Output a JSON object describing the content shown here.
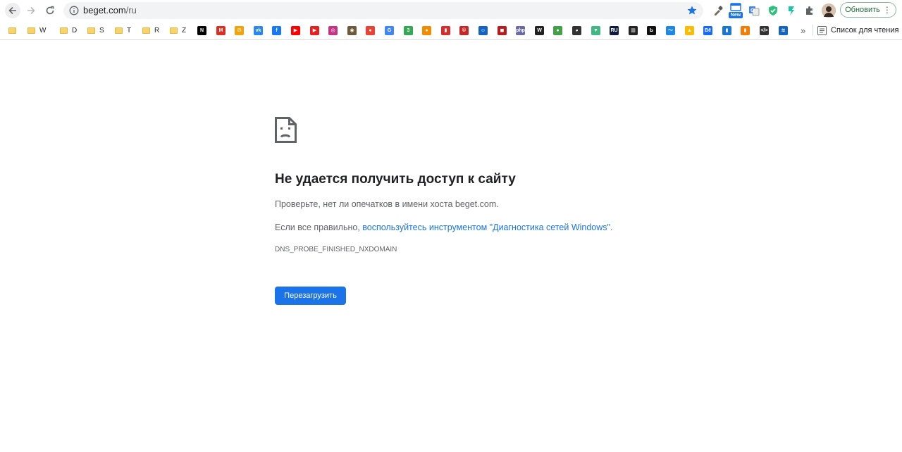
{
  "browser": {
    "url_host": "beget.com",
    "url_path": "/ru",
    "update_label": "Обновить",
    "reading_list_label": "Список для чтения",
    "overflow_label": "»",
    "new_badge": "New"
  },
  "bookmarks": [
    {
      "type": "folder",
      "label": ""
    },
    {
      "type": "folder",
      "label": "W"
    },
    {
      "type": "folder",
      "label": "D"
    },
    {
      "type": "folder",
      "label": "S"
    },
    {
      "type": "folder",
      "label": "T"
    },
    {
      "type": "folder",
      "label": "R"
    },
    {
      "type": "folder",
      "label": "Z"
    }
  ],
  "favicons": [
    {
      "icon": "notion-icon",
      "glyph": "N",
      "color": "#000000"
    },
    {
      "icon": "gmail-icon",
      "glyph": "M",
      "color": "#d93025"
    },
    {
      "icon": "mail-icon",
      "glyph": "✉",
      "color": "#f0a30a"
    },
    {
      "icon": "vk-icon",
      "glyph": "vk",
      "color": "#2787f5"
    },
    {
      "icon": "facebook-icon",
      "glyph": "f",
      "color": "#1877f2"
    },
    {
      "icon": "youtube-icon",
      "glyph": "▶",
      "color": "#ff0000"
    },
    {
      "icon": "youtube-music-icon",
      "glyph": "▶",
      "color": "#e52222"
    },
    {
      "icon": "instagram-icon",
      "glyph": "◎",
      "color": "#c13584"
    },
    {
      "icon": "eye-icon",
      "glyph": "◉",
      "color": "#6d5a3a"
    },
    {
      "icon": "maps-pin-icon",
      "glyph": "●",
      "color": "#ea4335"
    },
    {
      "icon": "translate-icon",
      "glyph": "G",
      "color": "#4285f4"
    },
    {
      "icon": "three-icon",
      "glyph": "3",
      "color": "#34a853"
    },
    {
      "icon": "basketball-icon",
      "glyph": "●",
      "color": "#f28b00"
    },
    {
      "icon": "analytics-icon",
      "glyph": "▮",
      "color": "#d32f2f"
    },
    {
      "icon": "copyright-icon",
      "glyph": "©",
      "color": "#c62828"
    },
    {
      "icon": "robot-icon",
      "glyph": "☺",
      "color": "#1565c0"
    },
    {
      "icon": "game-icon",
      "glyph": "◼",
      "color": "#b71c1c"
    },
    {
      "icon": "php-icon",
      "glyph": "php",
      "color": "#6a6aa8"
    },
    {
      "icon": "w-icon",
      "glyph": "W",
      "color": "#222222"
    },
    {
      "icon": "green-dot-icon",
      "glyph": "●",
      "color": "#43a047"
    },
    {
      "icon": "panda-icon",
      "glyph": "◕",
      "color": "#333333"
    },
    {
      "icon": "vue-icon",
      "glyph": "▼",
      "color": "#41b883"
    },
    {
      "icon": "ru-icon",
      "glyph": "RU",
      "color": "#0d1b3e"
    },
    {
      "icon": "archive-icon",
      "glyph": "▥",
      "color": "#222222"
    },
    {
      "icon": "b-icon",
      "glyph": "Ь",
      "color": "#111111"
    },
    {
      "icon": "wave-icon",
      "glyph": "〜",
      "color": "#1e88e5"
    },
    {
      "icon": "drive-icon",
      "glyph": "▲",
      "color": "#fbbc04"
    },
    {
      "icon": "behance-icon",
      "glyph": "Bē",
      "color": "#1769ff"
    },
    {
      "icon": "bars-icon",
      "glyph": "▮",
      "color": "#1976d2"
    },
    {
      "icon": "chart-icon",
      "glyph": "▮",
      "color": "#f57c00"
    },
    {
      "icon": "code-icon",
      "glyph": "</>",
      "color": "#333333"
    },
    {
      "icon": "wifi-icon",
      "glyph": "≋",
      "color": "#1565c0"
    }
  ],
  "error": {
    "title": "Не удается получить доступ к сайту",
    "check_text": "Проверьте, нет ли опечатков в имени хоста beget.com.",
    "suggest_prefix": "Если все правильно, ",
    "suggest_link": "воспользуйтесь инструментом \"Диагностика сетей Windows\"",
    "suggest_suffix": ".",
    "code": "DNS_PROBE_FINISHED_NXDOMAIN",
    "reload_label": "Перезагрузить"
  },
  "colors": {
    "accent": "#1a73e8",
    "update_border": "#8ab69a",
    "update_text": "#1e6b37"
  }
}
